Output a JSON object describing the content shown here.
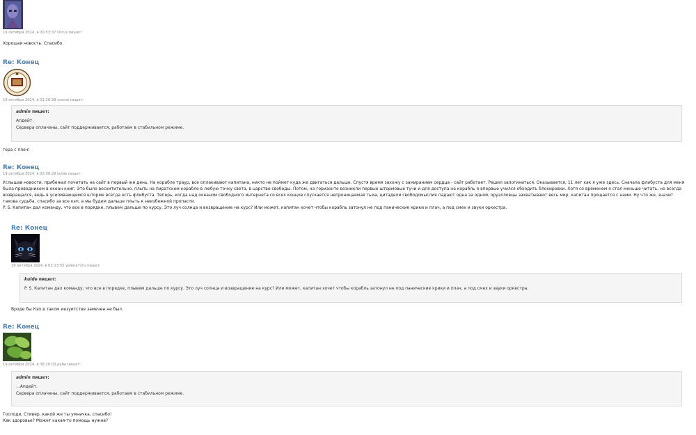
{
  "posts": [
    {
      "meta": "19 октября 2024, в 00:53:37 Orcus пишет:",
      "lines": [
        "Хорошая новость. Спасибо."
      ]
    },
    {
      "title": "Re: Конец",
      "meta": "19 октября 2024, в 01:26:58 vconst пишет:",
      "quote": {
        "author": "admin",
        "author_suffix": "пишет:",
        "lines": [
          "Апдейт.",
          "Сервера оплачены, сайт поддерживается, работаем в стабильном режиме."
        ]
      },
      "lines": [
        "гора с плеч!"
      ]
    },
    {
      "title": "Re: Конец",
      "meta": "19 октября 2024, в 02:00:29 kulde пишет:",
      "paragraph": "Услышав новости, прибежал почитать на сайт в первый же день. На корабле траур, все оплакивают капитана, никто не поймет куда же двигаться дальше. Спустя время захожу с замиранием сердца - сайт работает. Решил залогиниться. Оказывается, 11 лет как я уже здесь. Сначала флибуста для меня была проводником в океан книг. Это было восхитительно, плыть на пиратском корабле в любую точку света, в царстве свободы. Потом, на горизонте возникли первые штормовые тучи и для доступа на корабль я впервые учился обходить блокировки. Хотя со временем я стал меньше читать, но всегда возвращался, ведь в усиливающемся шторме всегда есть флибуста. Теперь, когда над океаном свободного интернета со всех концов спускается непроницаемая тьма, цитадели свободомыслия падают одна за одной, оруэлловцы захватывают весь мир, капитан прощается с нами. Ну что же, значит такова судьба. спасибо за все кэп, а мы будем дальше плыть к неизбежной пропасти.",
      "ps": "P. S. Капитан дал команду, что все в порядке, плывем дальше по курсу. Это луч солнца и возвращение на курс? Или может, капитан хочет чтобы корабль затонул не под панические крики и плач, а под смех и звуки оркестра."
    },
    {
      "title": "Re: Конец",
      "meta": "19 октября 2024, в 02:13:55 yelena72ru пишет:",
      "quote": {
        "author": "kulde",
        "author_suffix": "пишет:",
        "lines": [
          "P. S. Капитан дал команду, что все в порядке, плывем дальше по курсу. Это луч солнца и возвращение на курс? Или может, капитан хочет чтобы корабль затонул не под панические крики и плач, а под смех и звуки оркестра."
        ]
      },
      "lines": [
        "Вроде бы Кэп в таком иезуитстве замечен не был."
      ]
    },
    {
      "title": "Re: Конец",
      "meta": "19 октября 2024, в 08:20:03 paba пишет:",
      "quote": {
        "author": "admin",
        "author_suffix": "пишет:",
        "lines": [
          "...Апдейт.",
          "Сервера оплачены, сайт поддерживается, работаем в стабильном режиме."
        ]
      },
      "lines": [
        "Господи, Стивер, какой же ты умничка, спасибо!",
        "Как здоровье? Может какая-то помощь нужна?"
      ]
    }
  ],
  "colors": {
    "title": "#4e7fb0",
    "quote_bg": "#f5f5f5",
    "meta": "#888888"
  }
}
